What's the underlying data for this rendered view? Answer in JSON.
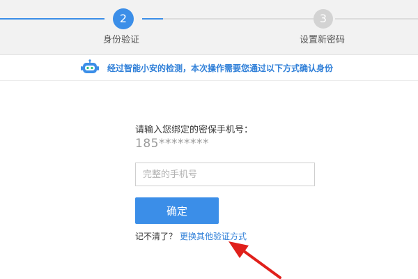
{
  "steps": {
    "current": {
      "number": "2",
      "label": "身份验证"
    },
    "next": {
      "number": "3",
      "label": "设置新密码"
    }
  },
  "notice": {
    "icon": "robot-icon",
    "text": "经过智能小安的检测，本次操作需要您通过以下方式确认身份"
  },
  "form": {
    "prompt": "请输入您绑定的密保手机号：",
    "masked_phone": "185********",
    "phone_input": {
      "value": "",
      "placeholder": "完整的手机号"
    },
    "confirm_label": "确定",
    "forget_text": "记不清了？",
    "switch_link": "更换其他验证方式"
  },
  "colors": {
    "accent": "#3b8ee8",
    "link": "#2f7fd8",
    "annotation_arrow": "#e0201b"
  }
}
